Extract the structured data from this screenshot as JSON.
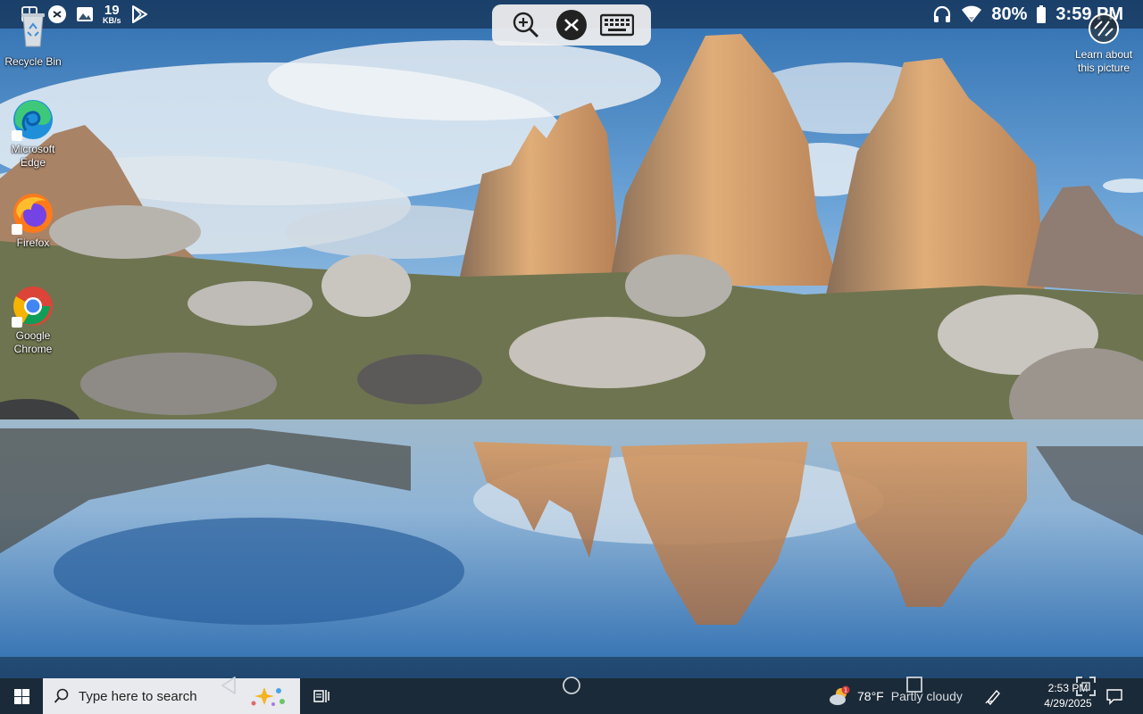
{
  "status_bar": {
    "net_speed_value": "19",
    "net_speed_unit": "KB/s",
    "battery_percent": "80%",
    "time": "3:59 PM",
    "icons": [
      "display-icon",
      "remote-desktop-app-icon",
      "gallery-icon",
      "play-store-icon",
      "headphones-icon",
      "wifi-icon",
      "battery-icon"
    ]
  },
  "remote_toolbar": {
    "buttons": [
      "zoom-in-icon",
      "remote-desktop-icon",
      "keyboard-icon"
    ]
  },
  "desktop_icons": [
    {
      "label": "Recycle Bin",
      "icon": "recycle-bin-icon"
    },
    {
      "label": "Microsoft Edge",
      "icon": "edge-icon"
    },
    {
      "label": "Firefox",
      "icon": "firefox-icon"
    },
    {
      "label": "Google Chrome",
      "icon": "chrome-icon"
    }
  ],
  "spotlight": {
    "label": "Learn about this picture",
    "icon": "camera-icon"
  },
  "taskbar": {
    "search_placeholder": "Type here to search",
    "weather_temp": "78°F",
    "weather_desc": "Partly cloudy",
    "weather_badge": "1",
    "clock_time": "2:53 PM",
    "clock_date": "4/29/2025"
  },
  "colors": {
    "taskbar": "#1b2a38",
    "search_box": "#e9eaee",
    "status_bar": "#0a1932",
    "sky": "#3d7fbf",
    "rock": "#d9a56e"
  }
}
